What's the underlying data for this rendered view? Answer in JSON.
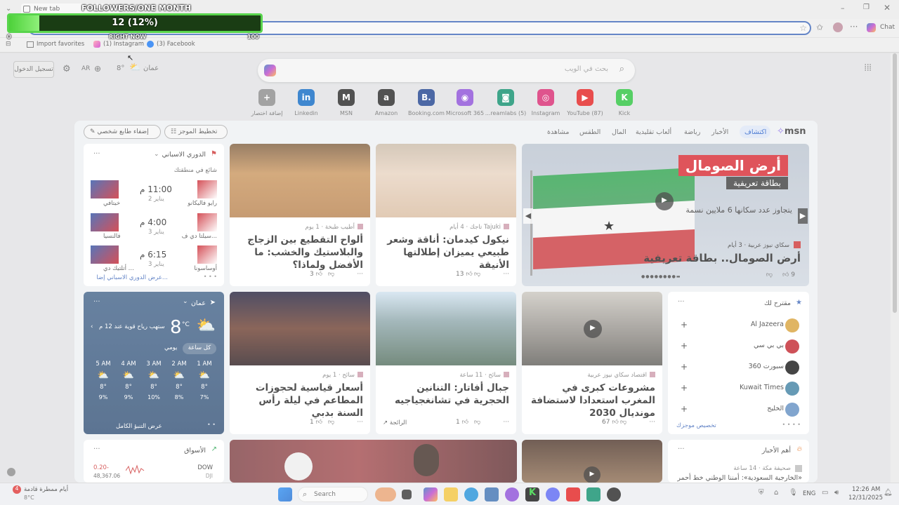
{
  "overlay": {
    "title": "FOLLOWERS/ONE MONTH",
    "value": "12 (12%)",
    "progress": 0.12,
    "min": "0",
    "max": "100",
    "sub": "RIGHT NOW"
  },
  "browser": {
    "tab_title": "New tab",
    "chat_label": "Chat",
    "bookmarks": [
      "Import favorites",
      "(1) Instagram",
      "(3) Facebook"
    ]
  },
  "ntp": {
    "login": "تسجيل الدخول",
    "lang": "AR",
    "temp": "8°",
    "city": "عمان",
    "search_placeholder": "بحث في الويب",
    "topsites": [
      {
        "label": "إضافة اختصار",
        "icon": "+",
        "color": "#888"
      },
      {
        "label": "Linkedin",
        "icon": "in",
        "color": "#0a66c2"
      },
      {
        "label": "MSN",
        "icon": "M",
        "color": "#222"
      },
      {
        "label": "Amazon",
        "icon": "a",
        "color": "#222"
      },
      {
        "label": "Booking.com",
        "icon": "B.",
        "color": "#1a3e8c"
      },
      {
        "label": "Microsoft 365",
        "icon": "◉",
        "color": "#8a4bd6"
      },
      {
        "label": "...reamlabs (5)",
        "icon": "◙",
        "color": "#0a8c6a"
      },
      {
        "label": "Instagram",
        "icon": "◎",
        "color": "#d6246e"
      },
      {
        "label": "YouTube (87)",
        "icon": "▶",
        "color": "#e21b1b"
      },
      {
        "label": "Kick",
        "icon": "K",
        "color": "#27c23a"
      }
    ],
    "feed_tabs": [
      "اكتشاف",
      "الأخبار",
      "رياضة",
      "ألعاب تقليدية",
      "المال",
      "الطقس",
      "مشاهدة"
    ],
    "msn": "msn",
    "personalize": "إضفاء طابع شخصي",
    "layout": "تخطيط الموجز"
  },
  "hero": {
    "overlay_title": "أرض الصومال",
    "overlay_sub": "بطاقة تعريفية",
    "caption": "يتجاوز عدد سكانها 6 ملايين نسمة",
    "source": "سكاي نيوز عربية · 3 أيام",
    "headline": "أرض الصومال.. بطاقة تعريفية",
    "likes": "9"
  },
  "articles": [
    {
      "source": "Tajuki تاجك · 4 أيام",
      "headline": "نيكول كيدمان: أناقة وشعر طبيعي يميزان إطلالتها الأنيقة",
      "likes": "13"
    },
    {
      "source": "أطيب طبخة · 1 يوم",
      "headline": "ألواح التقطيع بين الزجاج والبلاستيك والخشب: ما الأفضل ولماذا؟",
      "likes": "3"
    },
    {
      "source": "اقتصاد سكاي نيوز عربية",
      "headline": "مشروعات كبرى في المغرب استعدادا لاستضافة مونديال 2030",
      "likes": "67"
    },
    {
      "source": "سائح · 11 ساعة",
      "headline": "جبال أفاتار: التنانين الحجرية في تشانغجياجيه",
      "likes": "1",
      "tag": "الرائجة"
    },
    {
      "source": "سائح · 1 يوم",
      "headline": "أسعار قياسية لحجوزات المطاعم في ليلة رأس السنة بدبي",
      "likes": "1"
    }
  ],
  "league": {
    "title": "الدوري الاسباني",
    "subtitle": "شائع في منطقتك",
    "footer": "عرض الدوري الاسباني إضا...",
    "matches": [
      {
        "home": "رايو فاليكانو",
        "away": "خيتافي",
        "time": "11:00 م",
        "date": "2 يناير"
      },
      {
        "home": "سيلتا دي ف...",
        "away": "فالنسيا",
        "time": "4:00 م",
        "date": "3 يناير"
      },
      {
        "home": "أوساسونا",
        "away": "أتلتيك دي ...",
        "time": "6:15 م",
        "date": "3 يناير"
      }
    ]
  },
  "weather": {
    "city": "عمان",
    "temp": "8",
    "unit": "°C",
    "desc": "ستهب رياح قوية عند 12 م",
    "toggle_hourly": "كل ساعة",
    "toggle_daily": "يومي",
    "footer": "عرض التنبؤ الكامل",
    "hours": [
      {
        "time": "1 AM",
        "temp": "8°",
        "pct": "7%"
      },
      {
        "time": "2 AM",
        "temp": "8°",
        "pct": "8%"
      },
      {
        "time": "3 AM",
        "temp": "8°",
        "pct": "10%"
      },
      {
        "time": "4 AM",
        "temp": "8°",
        "pct": "9%"
      },
      {
        "time": "5 AM",
        "temp": "8°",
        "pct": "9%"
      }
    ]
  },
  "suggested": {
    "title": "مقترح لك",
    "footer": "تخصيص موجزك",
    "items": [
      "Al Jazeera",
      "بي بي سي",
      "سبورت 360",
      "Kuwait Times",
      "الخليج"
    ]
  },
  "markets": {
    "title": "الأسواق",
    "name": "DOW",
    "sub": "DJI",
    "change": "0.20-",
    "value": "48,367.06"
  },
  "top_news": {
    "title": "أهم الأخبار",
    "source": "صحيفة مكة · 14 ساعة",
    "headline": "«الخارجية السعودية»: أمننا الوطني خط أحمر"
  },
  "taskbar": {
    "weather_line1": "أيام ممطرة قادمة",
    "weather_line2": "8°C",
    "search": "Search",
    "lang": "ENG",
    "time": "12:26 AM",
    "date": "12/31/2025",
    "badge": "4"
  }
}
